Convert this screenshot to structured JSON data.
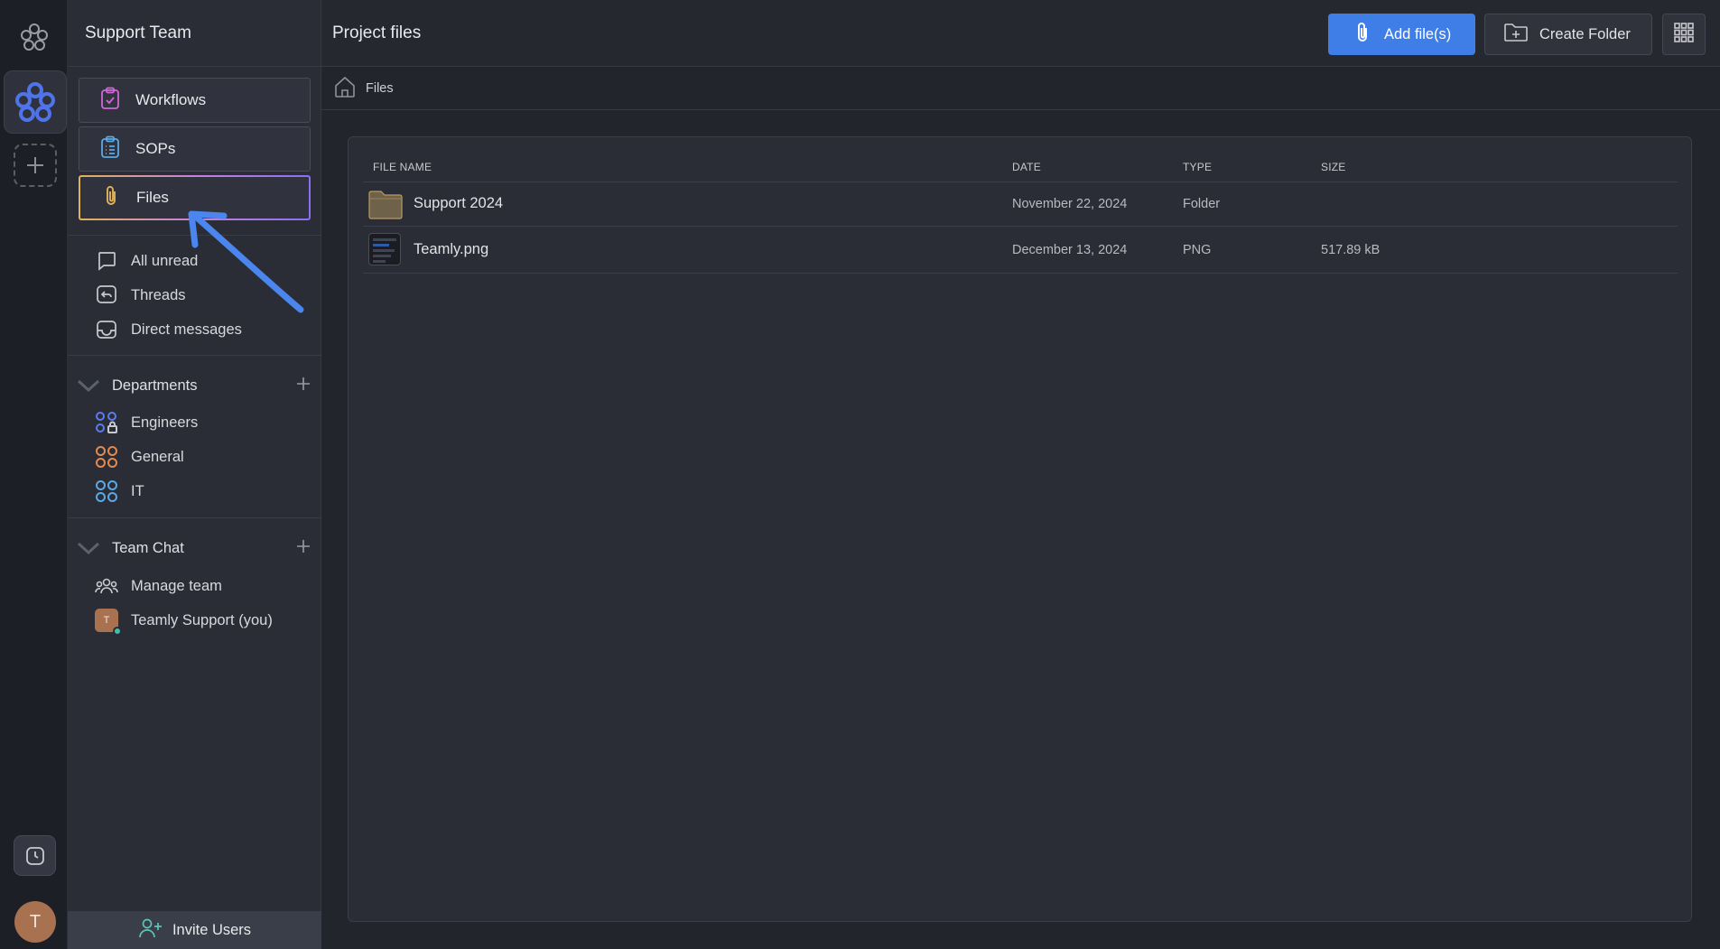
{
  "sidebar": {
    "team_name": "Support Team",
    "nav_cards": [
      {
        "label": "Workflows",
        "icon": "clipboard-check-icon",
        "color": "#d166d8"
      },
      {
        "label": "SOPs",
        "icon": "clipboard-list-icon",
        "color": "#5aa9e6"
      },
      {
        "label": "Files",
        "icon": "paperclip-icon",
        "color": "#e0b25a",
        "active": true
      }
    ],
    "items": [
      {
        "label": "All unread",
        "icon": "chat-bubble-icon"
      },
      {
        "label": "Threads",
        "icon": "threads-icon"
      },
      {
        "label": "Direct messages",
        "icon": "inbox-icon"
      }
    ],
    "departments": {
      "title": "Departments",
      "items": [
        {
          "label": "Engineers",
          "icon": "private-channel-icon",
          "color": "#5b7cf0"
        },
        {
          "label": "General",
          "icon": "channel-icon",
          "color": "#e48a4e"
        },
        {
          "label": "IT",
          "icon": "channel-icon",
          "color": "#5aa9e6"
        }
      ]
    },
    "team_chat": {
      "title": "Team Chat",
      "manage": "Manage team",
      "user": "Teamly Support (you)",
      "user_initial": "T"
    },
    "invite": "Invite Users"
  },
  "rail": {
    "avatar_initial": "T"
  },
  "header": {
    "title": "Project files",
    "add_files": "Add file(s)",
    "create_folder": "Create Folder"
  },
  "breadcrumb": {
    "current": "Files"
  },
  "table": {
    "columns": [
      "FILE NAME",
      "DATE",
      "TYPE",
      "SIZE"
    ],
    "rows": [
      {
        "name": "Support 2024",
        "date": "November 22, 2024",
        "type": "Folder",
        "size": ""
      },
      {
        "name": "Teamly.png",
        "date": "December 13, 2024",
        "type": "PNG",
        "size": "517.89 kB"
      }
    ]
  },
  "colors": {
    "accent": "#3f7ee6",
    "arrow": "#4a86ee"
  }
}
